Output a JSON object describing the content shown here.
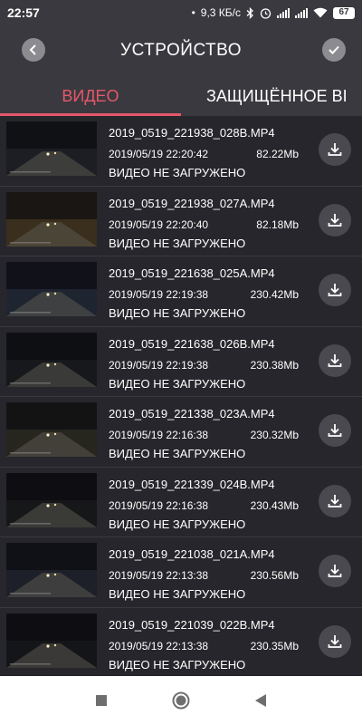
{
  "status_bar": {
    "time": "22:57",
    "network_speed": "9,3 КБ/с",
    "battery": "67",
    "icons": [
      "bluetooth-icon",
      "alarm-icon",
      "signal-icon",
      "signal-icon",
      "wifi-icon",
      "battery-icon"
    ]
  },
  "header": {
    "title": "УСТРОЙСТВО",
    "back_icon": "chevron-left-icon",
    "confirm_icon": "check-icon"
  },
  "tabs": [
    {
      "label": "ВИДЕО",
      "active": true
    },
    {
      "label": "ЗАЩИЩЁННОЕ ВІ",
      "active": false
    }
  ],
  "colors": {
    "accent": "#e5576a",
    "background": "#27262c",
    "bar": "#3a393f"
  },
  "files": [
    {
      "name": "2019_0519_221938_028B.MP4",
      "date": "2019/05/19 22:20:42",
      "size": "82.22Mb",
      "status": "ВИДЕО НЕ ЗАГРУЖЕНО"
    },
    {
      "name": "2019_0519_221938_027A.MP4",
      "date": "2019/05/19 22:20:40",
      "size": "82.18Mb",
      "status": "ВИДЕО НЕ ЗАГРУЖЕНО"
    },
    {
      "name": "2019_0519_221638_025A.MP4",
      "date": "2019/05/19 22:19:38",
      "size": "230.42Mb",
      "status": "ВИДЕО НЕ ЗАГРУЖЕНО"
    },
    {
      "name": "2019_0519_221638_026B.MP4",
      "date": "2019/05/19 22:19:38",
      "size": "230.38Mb",
      "status": "ВИДЕО НЕ ЗАГРУЖЕНО"
    },
    {
      "name": "2019_0519_221338_023A.MP4",
      "date": "2019/05/19 22:16:38",
      "size": "230.32Mb",
      "status": "ВИДЕО НЕ ЗАГРУЖЕНО"
    },
    {
      "name": "2019_0519_221339_024B.MP4",
      "date": "2019/05/19 22:16:38",
      "size": "230.43Mb",
      "status": "ВИДЕО НЕ ЗАГРУЖЕНО"
    },
    {
      "name": "2019_0519_221038_021A.MP4",
      "date": "2019/05/19 22:13:38",
      "size": "230.56Mb",
      "status": "ВИДЕО НЕ ЗАГРУЖЕНО"
    },
    {
      "name": "2019_0519_221039_022B.MP4",
      "date": "2019/05/19 22:13:38",
      "size": "230.35Mb",
      "status": "ВИДЕО НЕ ЗАГРУЖЕНО"
    }
  ],
  "navbar": {
    "icons": [
      "recent-apps-icon",
      "home-icon",
      "back-icon"
    ]
  }
}
